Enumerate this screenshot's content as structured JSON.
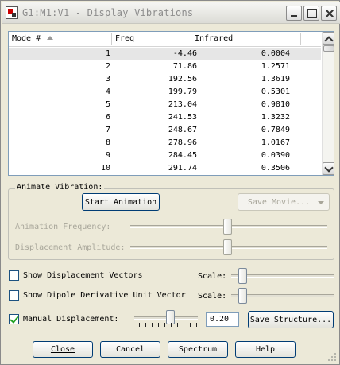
{
  "window": {
    "title": "G1:M1:V1 - Display Vibrations"
  },
  "table": {
    "columns": [
      "Mode #",
      "Freq",
      "Infrared"
    ],
    "rows": [
      {
        "mode": "1",
        "freq": "-4.46",
        "ir": "0.0004"
      },
      {
        "mode": "2",
        "freq": "71.86",
        "ir": "1.2571"
      },
      {
        "mode": "3",
        "freq": "192.56",
        "ir": "1.3619"
      },
      {
        "mode": "4",
        "freq": "199.79",
        "ir": "0.5301"
      },
      {
        "mode": "5",
        "freq": "213.04",
        "ir": "0.9810"
      },
      {
        "mode": "6",
        "freq": "241.53",
        "ir": "1.3232"
      },
      {
        "mode": "7",
        "freq": "248.67",
        "ir": "0.7849"
      },
      {
        "mode": "8",
        "freq": "278.96",
        "ir": "1.0167"
      },
      {
        "mode": "9",
        "freq": "284.45",
        "ir": "0.0390"
      },
      {
        "mode": "10",
        "freq": "291.74",
        "ir": "0.3506"
      }
    ],
    "selected_row": 0
  },
  "animate": {
    "group_label": "Animate Vibration:",
    "start_label": "Start Animation",
    "save_movie_label": "Save Movie...",
    "frequency_label": "Animation Frequency:",
    "amplitude_label": "Displacement Amplitude:"
  },
  "options": {
    "show_disp_vectors_label": "Show Displacement Vectors",
    "show_disp_vectors_checked": false,
    "show_dipole_label": "Show Dipole Derivative Unit Vector",
    "show_dipole_checked": false,
    "scale_label": "Scale:",
    "manual_disp_label": "Manual Displacement:",
    "manual_disp_checked": true,
    "manual_disp_value": "0.20",
    "save_structure_label": "Save Structure..."
  },
  "buttons": {
    "close": "Close",
    "cancel": "Cancel",
    "spectrum": "Spectrum",
    "help": "Help"
  }
}
